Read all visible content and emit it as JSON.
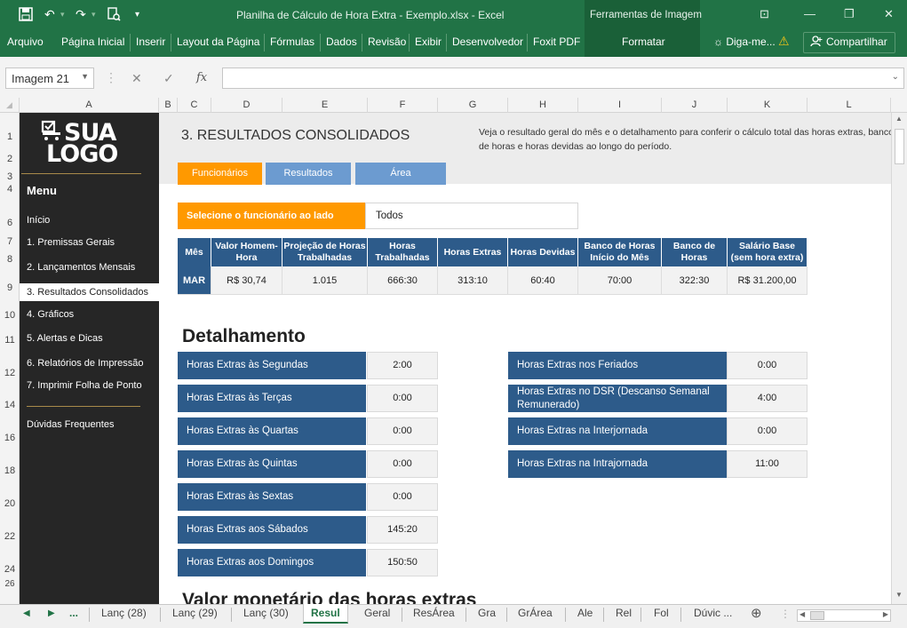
{
  "titlebar": {
    "title": "Planilha de Cálculo de Hora Extra - Exemplo.xlsx - Excel",
    "context_title": "Ferramentas de Imagem"
  },
  "ribbon": {
    "tabs": [
      "Arquivo",
      "Página Inicial",
      "Inserir",
      "Layout da Página",
      "Fórmulas",
      "Dados",
      "Revisão",
      "Exibir",
      "Desenvolvedor",
      "Foxit PDF"
    ],
    "context_tab": "Formatar",
    "tell_me": "Diga-me...",
    "share": "Compartilhar"
  },
  "formula_bar": {
    "name_box": "Imagem 21",
    "fx": "fx",
    "value": ""
  },
  "columns": [
    "A",
    "B",
    "C",
    "D",
    "E",
    "F",
    "G",
    "H",
    "I",
    "J",
    "K",
    "L"
  ],
  "rows": [
    "1",
    "2",
    "3",
    "4",
    "6",
    "7",
    "8",
    "9",
    "10",
    "11",
    "12",
    "14",
    "16",
    "18",
    "20",
    "22",
    "24",
    "26"
  ],
  "sidebar": {
    "logo_top": "SUA",
    "logo_bottom": "LOGO",
    "menu_title": "Menu",
    "items": [
      "Início",
      "1. Premissas Gerais",
      "2. Lançamentos Mensais",
      "3. Resultados Consolidados",
      "4. Gráficos",
      "5. Alertas e Dicas",
      "6. Relatórios de Impressão",
      "7. Imprimir Folha de Ponto"
    ],
    "faq": "Dúvidas Frequentes"
  },
  "main": {
    "title": "3. RESULTADOS CONSOLIDADOS",
    "description": "Veja o resultado geral do mês e o detalhamento para conferir o cálculo total das horas extras, banco de horas e horas devidas ao longo do período.",
    "tabs": [
      "Funcionários",
      "Resultados",
      "Área"
    ],
    "select_label": "Selecione o funcionário ao lado",
    "select_value": "Todos",
    "summary_headers": [
      "Mês",
      "Valor Homem-Hora",
      "Projeção de Horas Trabalhadas",
      "Horas Trabalhadas",
      "Horas Extras",
      "Horas Devidas",
      "Banco de Horas Início do Mês",
      "Banco de Horas",
      "Salário Base (sem hora extra)"
    ],
    "summary_values": [
      "MAR",
      "R$ 30,74",
      "1.015",
      "666:30",
      "313:10",
      "60:40",
      "70:00",
      "322:30",
      "R$ 31.200,00"
    ],
    "detail_title": "Detalhamento",
    "detail_left": [
      {
        "label": "Horas Extras às Segundas",
        "value": "2:00"
      },
      {
        "label": "Horas Extras às Terças",
        "value": "0:00"
      },
      {
        "label": "Horas Extras às Quartas",
        "value": "0:00"
      },
      {
        "label": "Horas Extras às Quintas",
        "value": "0:00"
      },
      {
        "label": "Horas Extras às Sextas",
        "value": "0:00"
      },
      {
        "label": "Horas Extras aos Sábados",
        "value": "145:20"
      },
      {
        "label": "Horas Extras aos Domingos",
        "value": "150:50"
      }
    ],
    "detail_right": [
      {
        "label": "Horas Extras nos Feriados",
        "value": "0:00"
      },
      {
        "label": "Horas Extras no DSR (Descanso Semanal Remunerado)",
        "value": "4:00"
      },
      {
        "label": "Horas Extras na Interjornada",
        "value": "0:00"
      },
      {
        "label": "Horas Extras na Intrajornada",
        "value": "11:00"
      }
    ],
    "next_section_title": "Valor monetário das horas extras"
  },
  "sheet_tabs": {
    "ellipsis": "...",
    "tabs": [
      "Lanç (28)",
      "Lanç (29)",
      "Lanç (30)",
      "Resul",
      "Geral",
      "ResÁrea",
      "Gra",
      "GrÁrea",
      "Ale",
      "Rel",
      "Fol",
      "Dúvic ..."
    ],
    "active": "Resul"
  },
  "colors": {
    "excel_green": "#217346",
    "orange": "#ff9900",
    "navy": "#2d5b8a",
    "tab_blue": "#6c9bd0",
    "sidebar": "#262626"
  }
}
